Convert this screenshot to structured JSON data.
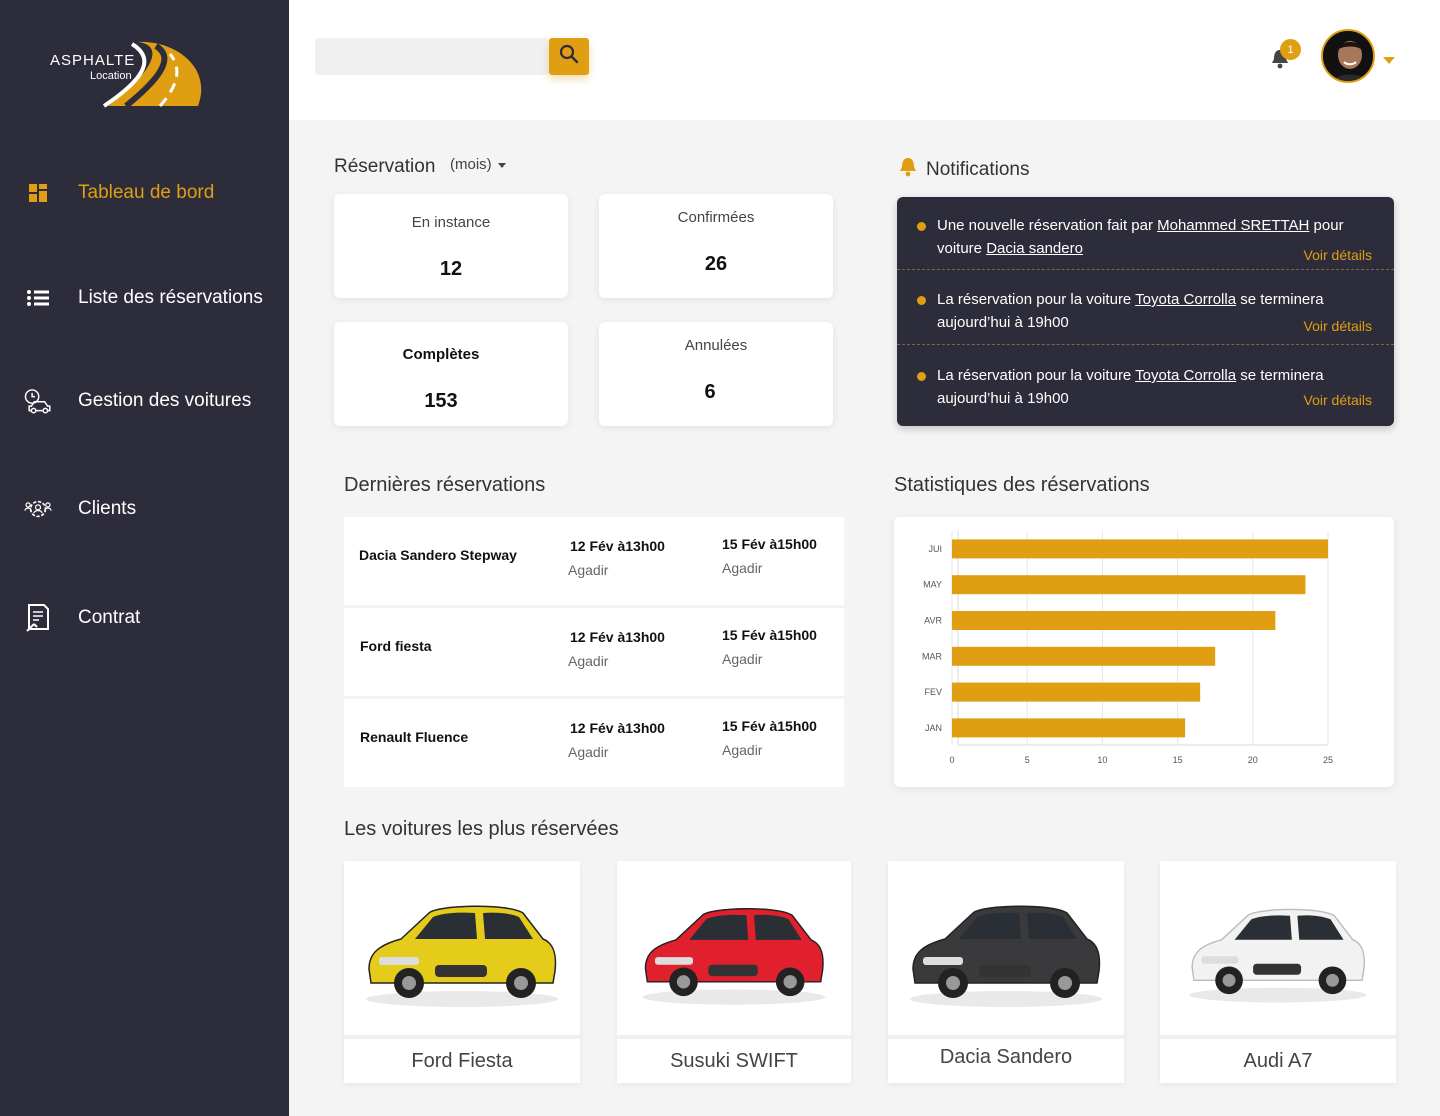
{
  "brand": {
    "name": "ASPHALTE",
    "sub": "Location",
    "accent": "#e09e12",
    "sidebar_bg": "#2d2c3a"
  },
  "sidebar": {
    "items": [
      {
        "label": "Tableau de bord",
        "icon": "dashboard-grid-icon",
        "active": true
      },
      {
        "label": "Liste des réservations",
        "icon": "list-icon",
        "active": false
      },
      {
        "label": "Gestion des  voitures",
        "icon": "car-clock-icon",
        "active": false
      },
      {
        "label": "Clients",
        "icon": "clients-gear-icon",
        "active": false
      },
      {
        "label": "Contrat",
        "icon": "contract-icon",
        "active": false
      }
    ]
  },
  "topbar": {
    "search": {
      "value": "",
      "placeholder": ""
    },
    "notifications_count": "1"
  },
  "reservation": {
    "title": "Réservation",
    "period": "(mois)",
    "cards": [
      {
        "label": "En instance",
        "value": "12"
      },
      {
        "label": "Confirmées",
        "value": "26"
      },
      {
        "label": "Complètes",
        "value": "153"
      },
      {
        "label": "Annulées",
        "value": "6"
      }
    ]
  },
  "notifications": {
    "title": "Notifications",
    "items": [
      {
        "pre": "Une nouvelle réservation fait par ",
        "who": "Mohammed SRETTAH",
        "mid": "  pour voiture ",
        "car": "Dacia sandero",
        "post": "",
        "link": "Voir détails"
      },
      {
        "pre": "La réservation pour la voiture ",
        "who": "",
        "mid": "",
        "car": "Toyota Corrolla",
        "post": " se terminera aujourd’hui à 19h00",
        "link": "Voir détails"
      },
      {
        "pre": "La réservation pour la voiture ",
        "who": "",
        "mid": "",
        "car": "Toyota Corrolla",
        "post": " se terminera aujourd’hui à 19h00",
        "link": "Voir détails"
      }
    ]
  },
  "latest": {
    "title": "Dernières réservations",
    "rows": [
      {
        "car": "Dacia Sandero Stepway",
        "start": "12 Fév à13h00",
        "start_city": "Agadir",
        "end": "15 Fév à15h00",
        "end_city": "Agadir"
      },
      {
        "car": "Ford fiesta",
        "start": "12 Fév à13h00",
        "start_city": "Agadir",
        "end": "15 Fév à15h00",
        "end_city": "Agadir"
      },
      {
        "car": "Renault Fluence",
        "start": "12 Fév à13h00",
        "start_city": "Agadir",
        "end": "15 Fév à15h00",
        "end_city": "Agadir"
      }
    ]
  },
  "stats": {
    "title": "Statistiques des réservations"
  },
  "chart_data": {
    "type": "bar",
    "orientation": "horizontal",
    "categories": [
      "JUI",
      "MAY",
      "AVR",
      "MAR",
      "FEV",
      "JAN"
    ],
    "values": [
      25,
      23.5,
      21.5,
      17.5,
      16.5,
      15.5
    ],
    "xlim": [
      0,
      25
    ],
    "xticks": [
      "0",
      "5",
      "10",
      "15",
      "20",
      "25"
    ],
    "grid": true,
    "color": "#e09e12",
    "title": "",
    "xlabel": "",
    "ylabel": ""
  },
  "most_booked": {
    "title": "Les voitures les plus réservées",
    "cars": [
      {
        "name": "Ford Fiesta",
        "color": "#e6cc1a"
      },
      {
        "name": "Susuki SWIFT",
        "color": "#e0202c"
      },
      {
        "name": "Dacia Sandero",
        "color": "#3a3a3c"
      },
      {
        "name": "Audi A7",
        "color": "#f2f2f2"
      }
    ]
  }
}
